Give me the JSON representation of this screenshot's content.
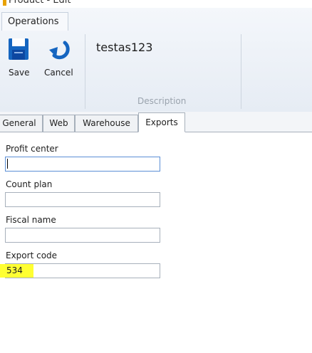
{
  "window": {
    "title": "Product - Edit"
  },
  "ribbon": {
    "tab_label": "Operations",
    "save_label": "Save",
    "cancel_label": "Cancel",
    "description_value": "testas123",
    "description_group_label": "Description"
  },
  "tabs": [
    {
      "label": "General"
    },
    {
      "label": "Web"
    },
    {
      "label": "Warehouse"
    },
    {
      "label": "Exports",
      "active": true
    }
  ],
  "form": {
    "profit_center": {
      "label": "Profit center",
      "value": ""
    },
    "count_plan": {
      "label": "Count plan",
      "value": ""
    },
    "fiscal_name": {
      "label": "Fiscal name",
      "value": ""
    },
    "export_code": {
      "label": "Export code",
      "value": "534"
    }
  },
  "colors": {
    "accent": "#1565c0",
    "highlight": "#ffff33"
  },
  "icons": [
    "save-icon",
    "cancel-icon"
  ]
}
